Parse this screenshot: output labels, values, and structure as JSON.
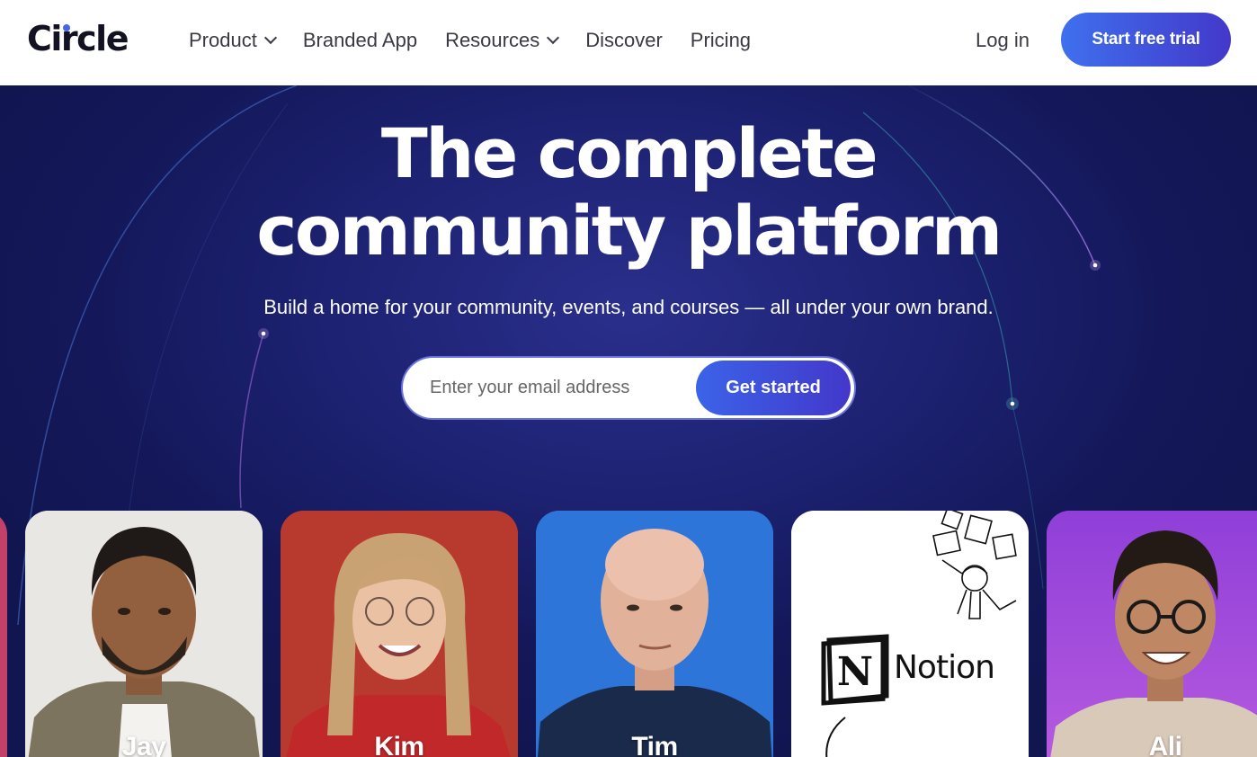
{
  "header": {
    "logo": "Circle",
    "nav": [
      {
        "label": "Product",
        "has_dropdown": true
      },
      {
        "label": "Branded App",
        "has_dropdown": false
      },
      {
        "label": "Resources",
        "has_dropdown": true
      },
      {
        "label": "Discover",
        "has_dropdown": false
      },
      {
        "label": "Pricing",
        "has_dropdown": false
      }
    ],
    "login_label": "Log in",
    "trial_label": "Start free trial"
  },
  "hero": {
    "title_line1": "The complete",
    "title_line2": "community platform",
    "subtitle": "Build a home for your community, events, and courses — all under your own brand.",
    "email_placeholder": "Enter your email address",
    "cta_label": "Get started"
  },
  "cards": [
    {
      "name": "Jay",
      "background": "#e8e6e3"
    },
    {
      "name": "Kim",
      "background": "#c0392b"
    },
    {
      "name": "Tim",
      "background": "#2a72d6"
    },
    {
      "name": "Notion",
      "background": "#ffffff"
    },
    {
      "name": "Ali",
      "background": "#8b3fd6"
    }
  ],
  "colors": {
    "accent": "#4338ca",
    "hero_bg": "#1c2170",
    "text_dark": "#121222"
  }
}
